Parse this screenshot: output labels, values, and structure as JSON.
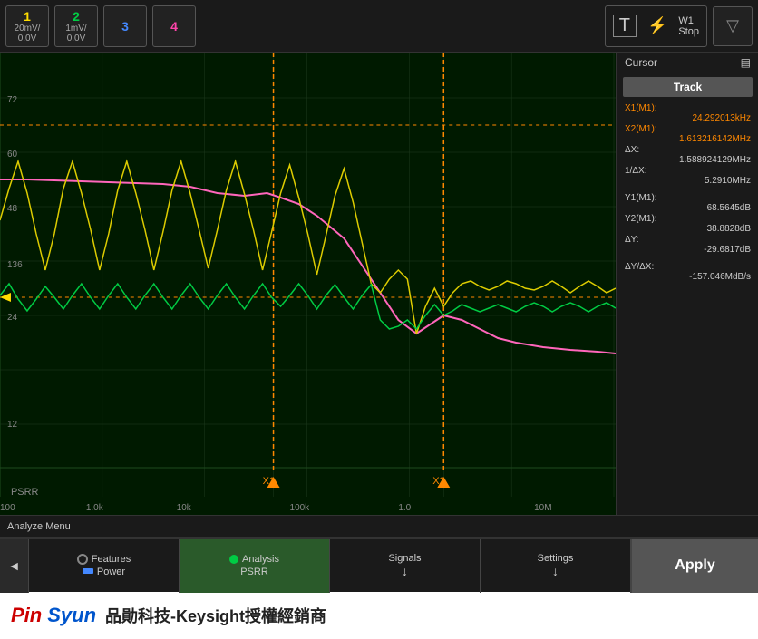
{
  "toolbar": {
    "ch1": {
      "label": "1",
      "volt": "20mV/",
      "offset": "0.0V"
    },
    "ch2": {
      "label": "2",
      "volt": "1mV/",
      "offset": "0.0V"
    },
    "ch3": {
      "label": "3"
    },
    "ch4": {
      "label": "4"
    },
    "trigger_t": "T",
    "trigger_w1": "W1",
    "trigger_stop": "Stop",
    "run_icon": "▽"
  },
  "cursor_panel": {
    "title": "Cursor",
    "track_label": "Track",
    "x1_label": "X1(M1):",
    "x1_value": "24.292013kHz",
    "x2_label": "X2(M1):",
    "x2_value": "1.613216142MHz",
    "dx_label": "ΔX:",
    "dx_value": "1.588924129MHz",
    "inv_dx_label": "1/ΔX:",
    "inv_dx_value": "5.2910MHz",
    "y1_label": "Y1(M1):",
    "y1_value": "68.5645dB",
    "y2_label": "Y2(M1):",
    "y2_value": "38.8828dB",
    "dy_label": "ΔY:",
    "dy_value": "-29.6817dB",
    "dy_dx_label": "ΔY/ΔX:",
    "dy_dx_value": "-157.046MdB/s"
  },
  "plot": {
    "y_labels": [
      "72",
      "60",
      "48",
      "136",
      "24",
      "12"
    ],
    "x_labels": [
      "100",
      "1.0k",
      "10k",
      "100k",
      "1.0",
      "10M"
    ],
    "channel_label": "PSRR",
    "x_marker1": "X1",
    "x_marker2": "X2"
  },
  "analyze_bar": {
    "label": "Analyze Menu"
  },
  "bottom_menu": {
    "nav_arrow": "◄",
    "tabs": [
      {
        "id": "features",
        "dot_color": "none",
        "has_radio": true,
        "top_label": "Features",
        "sub_label": "Power",
        "has_arrow": false
      },
      {
        "id": "analysis",
        "dot_color": "green",
        "top_label": "Analysis",
        "sub_label": "PSRR",
        "active": true,
        "has_arrow": false
      },
      {
        "id": "signals",
        "dot_color": "none",
        "top_label": "Signals",
        "sub_label": "↓",
        "has_arrow": true
      },
      {
        "id": "settings",
        "dot_color": "none",
        "top_label": "Settings",
        "sub_label": "↓",
        "has_arrow": true
      }
    ],
    "apply_label": "Apply"
  },
  "footer": {
    "logo_pin": "Pin",
    "logo_syun": "Syun",
    "text": "品勛科技-Keysight授權經銷商"
  }
}
